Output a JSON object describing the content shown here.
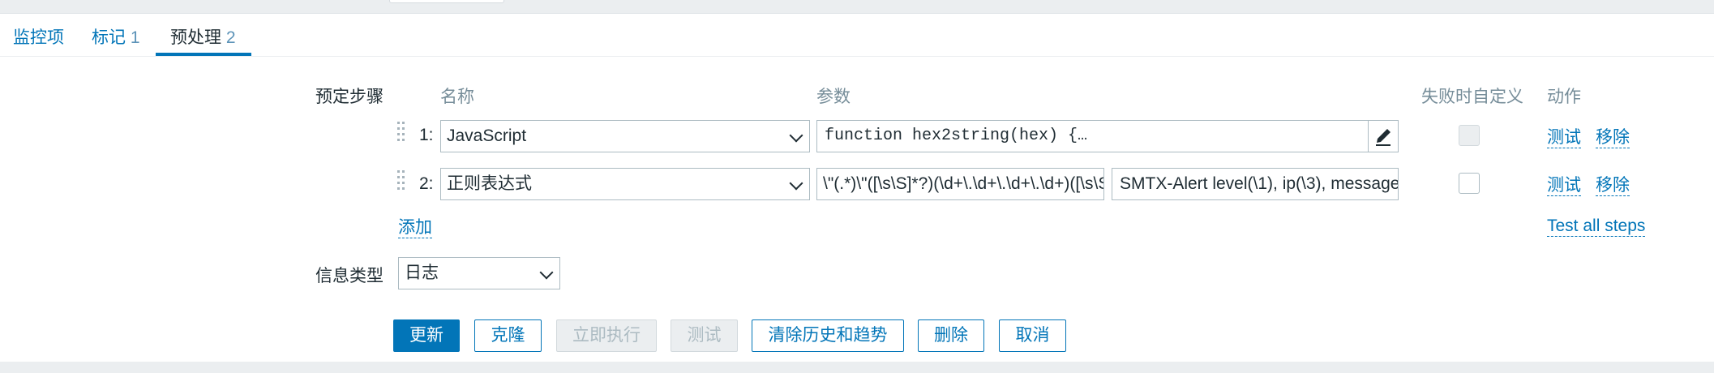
{
  "tabs": [
    {
      "label": "监控项",
      "count": ""
    },
    {
      "label": "标记",
      "count": "1"
    },
    {
      "label": "预处理",
      "count": "2"
    }
  ],
  "preprocessing": {
    "label": "预定步骤",
    "headers": {
      "name": "名称",
      "params": "参数",
      "custom_on_fail": "失败时自定义",
      "actions": "动作"
    },
    "steps": [
      {
        "number": "1:",
        "type": "JavaScript",
        "param1": "function hex2string(hex) {…",
        "custom_on_fail_checked": false,
        "custom_on_fail_disabled": true,
        "test_label": "测试",
        "remove_label": "移除"
      },
      {
        "number": "2:",
        "type": "正则表达式",
        "param1": "\\\"(.*)\\\"([\\s\\S]*?)(\\d+\\.\\d+\\.\\d+\\.\\d+)([\\s\\S]",
        "param2": "SMTX-Alert level(\\1), ip(\\3), message",
        "custom_on_fail_checked": false,
        "custom_on_fail_disabled": false,
        "test_label": "测试",
        "remove_label": "移除"
      }
    ],
    "add_label": "添加",
    "test_all_label": "Test all steps"
  },
  "info_type": {
    "label": "信息类型",
    "value": "日志"
  },
  "buttons": {
    "update": "更新",
    "clone": "克隆",
    "execute_now": "立即执行",
    "test": "测试",
    "clear_history": "清除历史和趋势",
    "delete": "删除",
    "cancel": "取消"
  },
  "icons": {
    "edit": "pencil-icon",
    "drag": "drag-handle-icon",
    "dropdown": "chevron-down-icon"
  },
  "colors": {
    "accent": "#0275b8",
    "background": "#ebeef0",
    "text": "#1f2c33",
    "muted": "#768d99",
    "border": "#acbbc2"
  }
}
